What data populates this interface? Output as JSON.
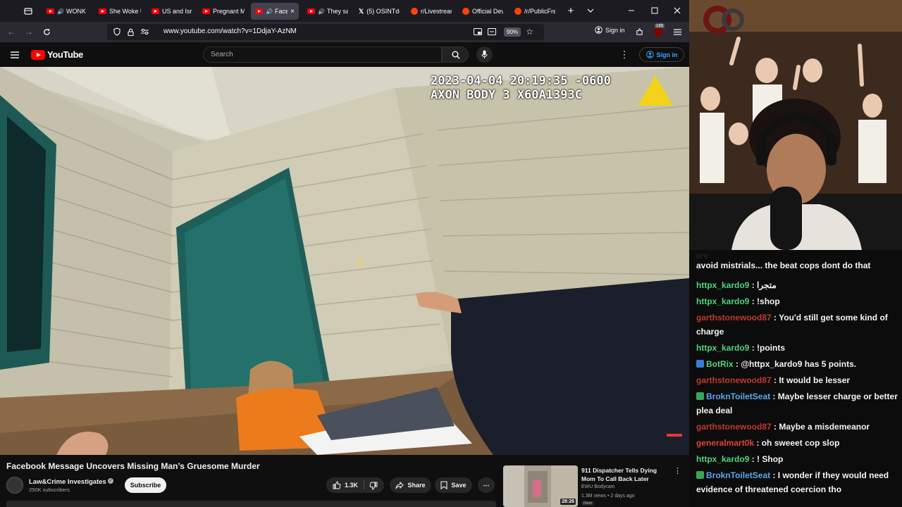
{
  "browser": {
    "tabs": [
      {
        "label": "WONK",
        "kind": "yt",
        "audio": true
      },
      {
        "label": "She Woke U",
        "kind": "yt"
      },
      {
        "label": "US and Isra",
        "kind": "yt"
      },
      {
        "label": "Pregnant M",
        "kind": "yt"
      },
      {
        "label": "Face",
        "kind": "yt",
        "audio": true,
        "active": true
      },
      {
        "label": "They sa",
        "kind": "yt",
        "audio": true
      },
      {
        "label": "(5) OSINTde",
        "kind": "x"
      },
      {
        "label": "r/Livestrean",
        "kind": "reddit"
      },
      {
        "label": "Official Dev",
        "kind": "reddit"
      },
      {
        "label": "/r/PublicFre",
        "kind": "reddit"
      }
    ],
    "url": "www.youtube.com/watch?v=1DdjaY-AzNM",
    "zoom": "90%",
    "signin_label": "Sign in",
    "notification_count": "168"
  },
  "youtube": {
    "logo_text": "YouTube",
    "search_placeholder": "Search",
    "signin_label": "Sign in",
    "video": {
      "overlay_timestamp": "2023-04-04 20:19:35 -0600",
      "overlay_device": "AXON BODY 3 X60A1393C",
      "title": "Facebook Message Uncovers Missing Man’s Gruesome Murder",
      "channel": "Law&Crime Investigates",
      "subscribers": "250K subscribers",
      "subscribe_label": "Subscribe",
      "likes": "1.3K",
      "share_label": "Share",
      "save_label": "Save"
    },
    "recommended": {
      "title": "911 Dispatcher Tells Dying Mom To Call Back Later",
      "channel": "EWU Bodycam",
      "meta": "1.3M views • 2 days ago",
      "badge": "New",
      "duration": "28:26"
    }
  },
  "stream": {
    "chat": [
      {
        "user": "",
        "text": "avoid mistrials... the beat cops dont do that",
        "user_color": "#f4f4f4"
      },
      {
        "user": "httpx_kardo9",
        "text": " : متجرا",
        "user_color": "#4fd47b"
      },
      {
        "user": "httpx_kardo9",
        "text": " : !shop",
        "user_color": "#4fd47b"
      },
      {
        "user": "garthstonewood87",
        "text": " : You'd still get some kind of charge",
        "user_color": "#c0392b"
      },
      {
        "user": "httpx_kardo9",
        "text": " : !points",
        "user_color": "#4fd47b"
      },
      {
        "user": "BotRix",
        "text": " : @httpx_kardo9 has 5 points.",
        "user_color": "#4fd47b"
      },
      {
        "user": "garthstonewood87",
        "text": " : It would be lesser",
        "user_color": "#c0392b"
      },
      {
        "user": "BroknToiletSeat",
        "text": " : Maybe lesser charge or better plea deal",
        "user_color": "#5aa9f0"
      },
      {
        "user": "garthstonewood87",
        "text": " : Maybe a misdemeanor",
        "user_color": "#c0392b"
      },
      {
        "user": "generalmart0k",
        "text": " : oh sweeet cop slop",
        "user_color": "#e0442f"
      },
      {
        "user": "httpx_kardo9",
        "text": " : ! Shop",
        "user_color": "#4fd47b"
      },
      {
        "user": "BroknToiletSeat",
        "text": " : I wonder if they would need evidence of threatened coercion tho",
        "user_color": "#5aa9f0"
      }
    ],
    "partial_line": "are"
  }
}
